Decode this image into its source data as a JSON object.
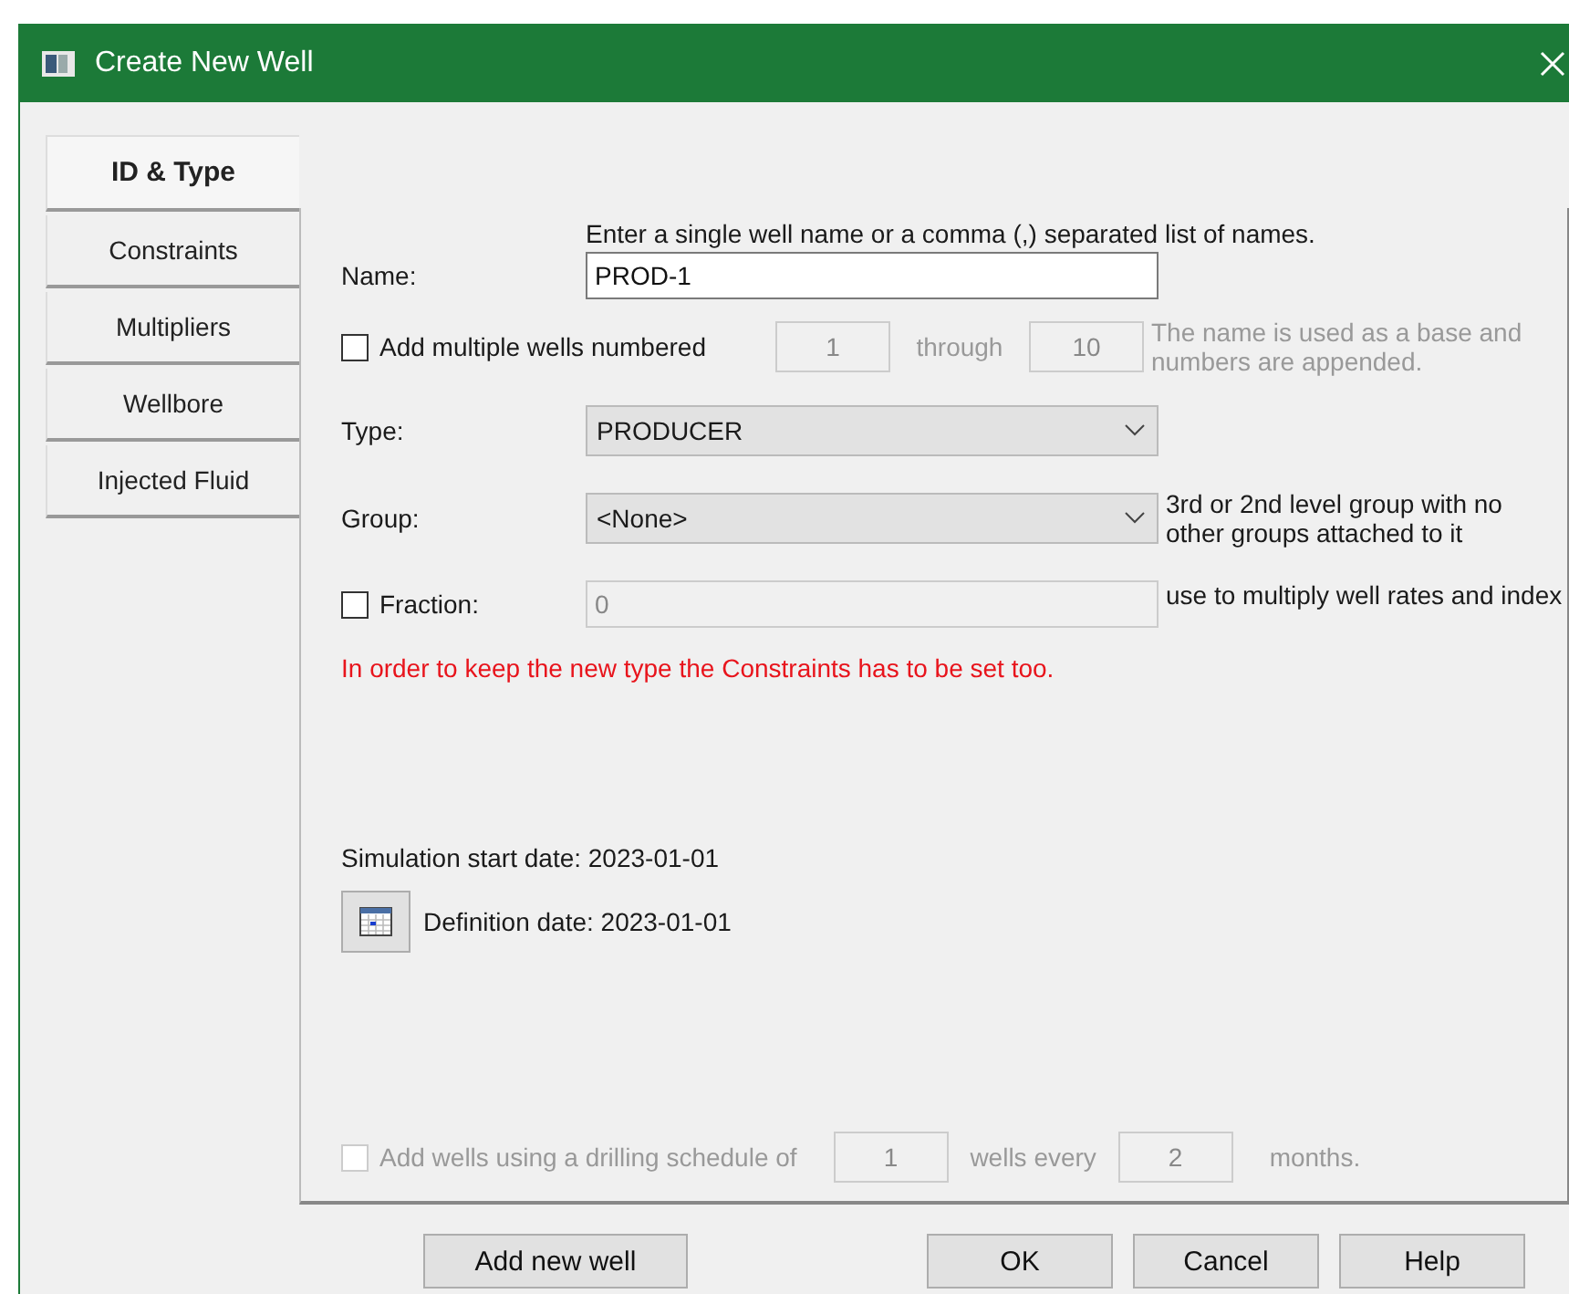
{
  "window": {
    "title": "Create New Well"
  },
  "tabs": [
    {
      "label": "ID & Type",
      "selected": true
    },
    {
      "label": "Constraints",
      "selected": false
    },
    {
      "label": "Multipliers",
      "selected": false
    },
    {
      "label": "Wellbore",
      "selected": false
    },
    {
      "label": "Injected Fluid",
      "selected": false
    }
  ],
  "name_hint": "Enter a single well name or a comma (,) separated list of names.",
  "name": {
    "label": "Name:",
    "value": "PROD-1"
  },
  "multiple": {
    "label": "Add multiple wells numbered",
    "checked": false,
    "from": "1",
    "through_label": "through",
    "to": "10",
    "note": "The name is used as a base and numbers are appended."
  },
  "type": {
    "label": "Type:",
    "value": "PRODUCER"
  },
  "group": {
    "label": "Group:",
    "value": "<None>",
    "note": "3rd or 2nd level group with no other groups attached to it"
  },
  "fraction": {
    "label": "Fraction:",
    "checked": false,
    "value": "0",
    "note": "use to multiply well rates and index"
  },
  "warning": "In order to keep the new type the Constraints has to be set too.",
  "simulation_start": "Simulation start date: 2023-01-01",
  "definition_date": "Definition date: 2023-01-01",
  "schedule": {
    "label": "Add wells using a drilling schedule of",
    "disabled": true,
    "checked": false,
    "wells": "1",
    "every_label": "wells every",
    "months": "2",
    "months_label": "months."
  },
  "buttons": [
    "Add new well",
    "OK",
    "Cancel",
    "Help"
  ]
}
